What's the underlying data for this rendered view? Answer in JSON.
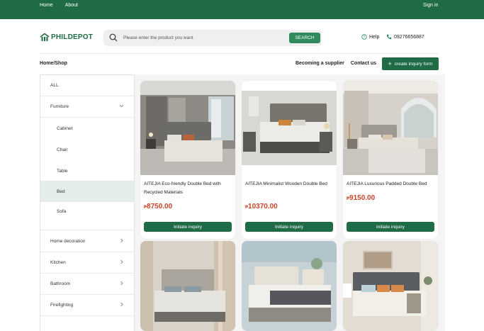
{
  "topbar": {
    "nav": [
      "Home",
      "About"
    ],
    "signin": "Sign in"
  },
  "header": {
    "logo_text": "PHILDEPOT",
    "search_placeholder": "Please enter the product you want",
    "search_button": "SEARCH",
    "help_label": "Help",
    "phone": "09276656887"
  },
  "subbar": {
    "breadcrumb": "Home/Shop",
    "links": [
      "Becoming a supplier",
      "Contact us"
    ],
    "inquiry_button": "create inquiry form"
  },
  "sidebar": {
    "items": [
      {
        "label": "ALL"
      },
      {
        "label": "Furniture"
      },
      {
        "label": "Cabinet"
      },
      {
        "label": "Chair"
      },
      {
        "label": "Table"
      },
      {
        "label": "Bed"
      },
      {
        "label": "Sofa"
      },
      {
        "label": "Home decoration"
      },
      {
        "label": "Kitchen"
      },
      {
        "label": "Bathroom"
      },
      {
        "label": "Firefighting"
      }
    ],
    "active": "Bed"
  },
  "products": [
    {
      "title": "AITEJIA Eco-friendly Double Bed with Recycled Materials",
      "currency": "₱",
      "price": "8750.00",
      "button": "Initiate inquiry"
    },
    {
      "title": "AITEJIA Minimalist Wooden Double Bed",
      "currency": "₱",
      "price": "10370.00",
      "button": "Initiate inquiry"
    },
    {
      "title": "AITEJIA Luxurious Padded Double Bed",
      "currency": "₱",
      "price": "9150.00",
      "button": "Initiate inquiry"
    },
    {
      "title": "",
      "currency": "",
      "price": "",
      "button": ""
    },
    {
      "title": "",
      "currency": "",
      "price": "",
      "button": ""
    },
    {
      "title": "",
      "currency": "",
      "price": "",
      "button": ""
    }
  ],
  "colors": {
    "brand_green": "#1e6b45",
    "search_green": "#2f8a5c",
    "price_red": "#c8442c",
    "active_bg": "#e5ede8"
  },
  "icons": {
    "search": "search-icon",
    "help": "help-circle-icon",
    "phone": "phone-icon",
    "plus": "plus-icon",
    "chevron_down": "chevron-down-icon",
    "chevron_right": "chevron-right-icon",
    "logo": "house-logo-icon"
  }
}
